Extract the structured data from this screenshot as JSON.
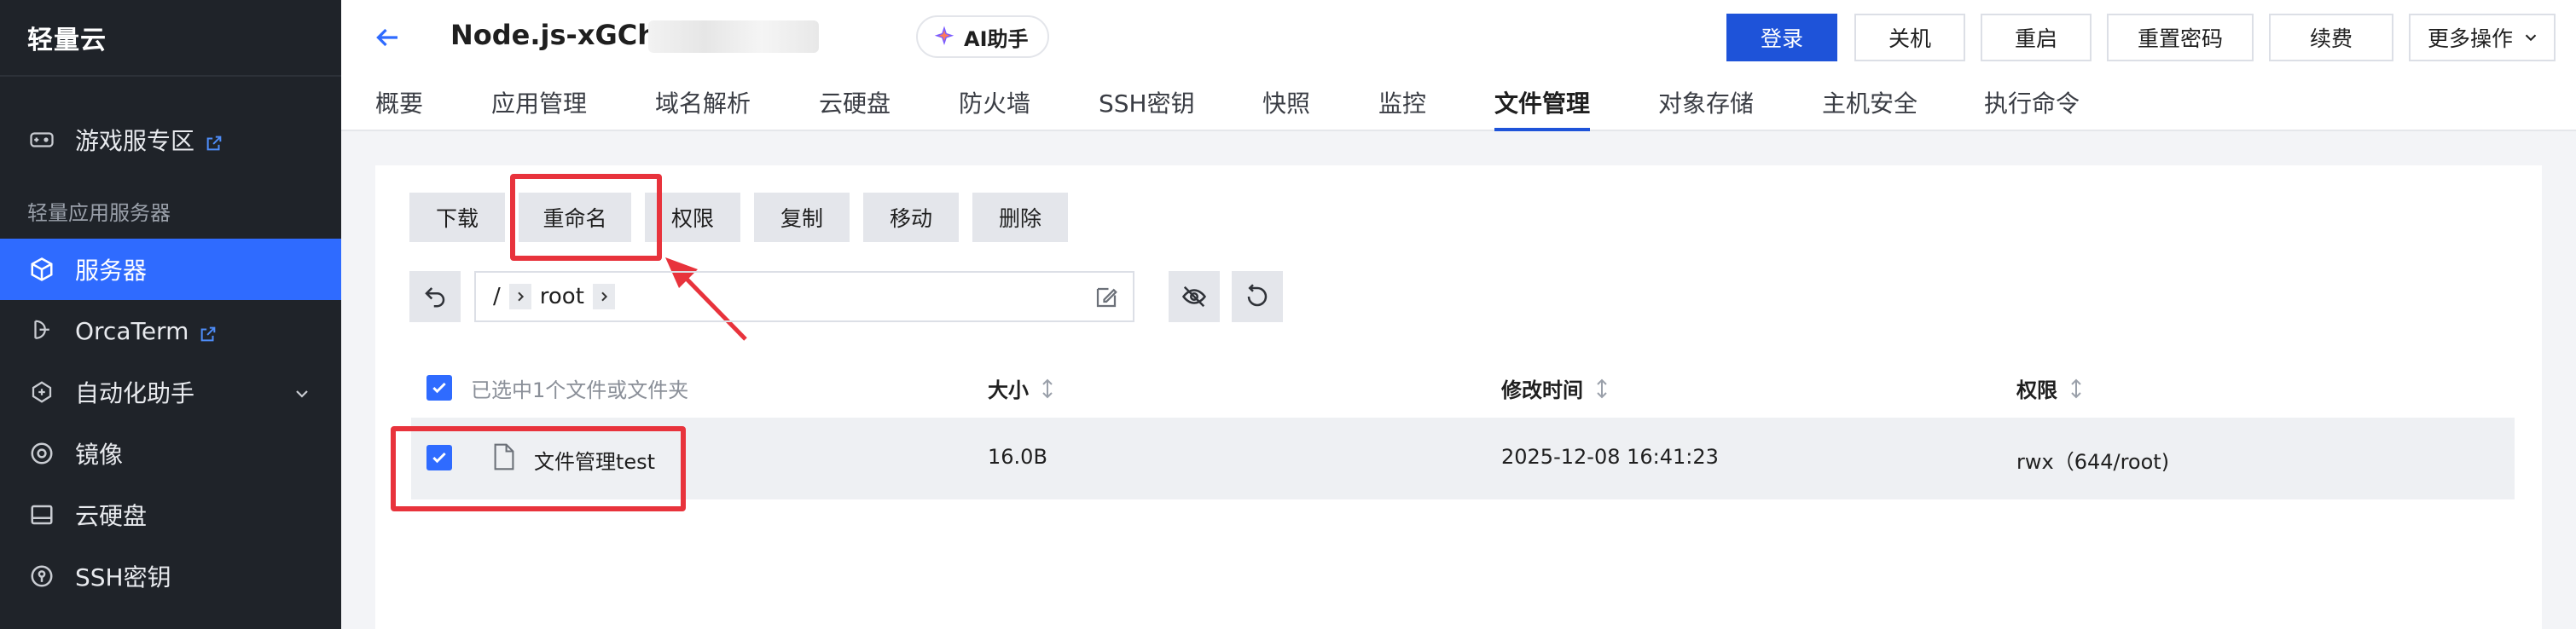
{
  "sidebar": {
    "brand": "轻量云",
    "group_label": "轻量应用服务器",
    "items": [
      {
        "label": "游戏服专区",
        "icon": "gamepad-icon"
      },
      {
        "label": "服务器",
        "icon": "cube-icon"
      },
      {
        "label": "OrcaTerm",
        "icon": "orca-icon"
      },
      {
        "label": "自动化助手",
        "icon": "automation-icon"
      },
      {
        "label": "镜像",
        "icon": "image-disc-icon"
      },
      {
        "label": "云硬盘",
        "icon": "disk-icon"
      },
      {
        "label": "SSH密钥",
        "icon": "key-icon"
      }
    ],
    "active_index": 1
  },
  "header": {
    "title": "Node.js-xGCh",
    "ai_button": "AI助手",
    "actions": [
      "登录",
      "关机",
      "重启",
      "重置密码",
      "续费",
      "更多操作"
    ]
  },
  "tabs": [
    "概要",
    "应用管理",
    "域名解析",
    "云硬盘",
    "防火墙",
    "SSH密钥",
    "快照",
    "监控",
    "文件管理",
    "对象存储",
    "主机安全",
    "执行命令"
  ],
  "active_tab": "文件管理",
  "toolbar": {
    "buttons": [
      "下载",
      "重命名",
      "权限",
      "复制",
      "移动",
      "删除"
    ]
  },
  "path": {
    "root_sep": "/",
    "segment": "root"
  },
  "table": {
    "selection_text": "已选中1个文件或文件夹",
    "headers": [
      "大小",
      "修改时间",
      "权限"
    ],
    "rows": [
      {
        "name": "文件管理test",
        "size": "16.0B",
        "modified": "2025-12-08 16:41:23",
        "perm": "rwx（644/root)"
      }
    ]
  },
  "colors": {
    "sidebar_bg": "#1f2329",
    "accent": "#2f6bff",
    "primary_button": "#1e53d9",
    "highlight_red": "#e8333c"
  }
}
